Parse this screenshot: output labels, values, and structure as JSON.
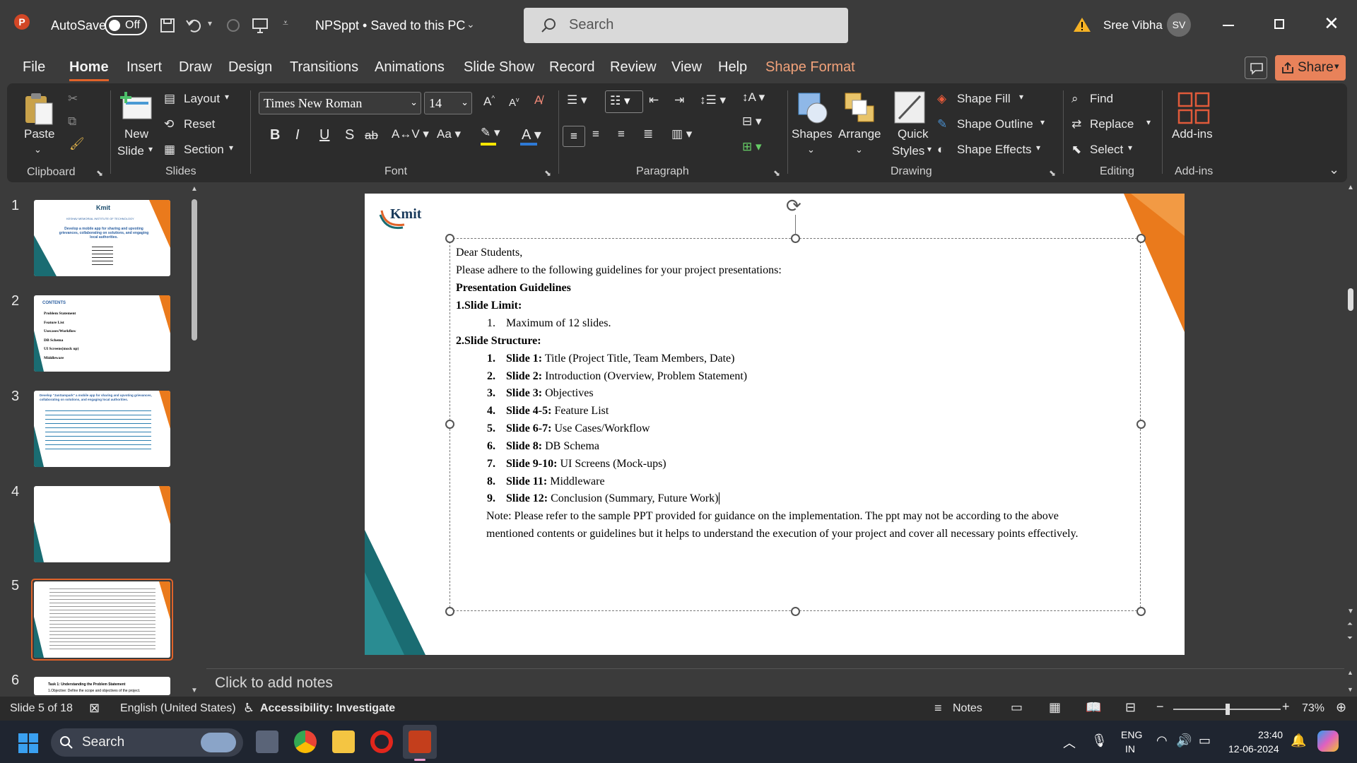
{
  "app": {
    "autosave_label": "AutoSave",
    "autosave_state": "Off",
    "doc_title": "NPSppt • Saved to this PC",
    "search_placeholder": "Search",
    "user_name": "Sree Vibha",
    "user_initials": "SV"
  },
  "menu": {
    "tabs": [
      "File",
      "Home",
      "Insert",
      "Draw",
      "Design",
      "Transitions",
      "Animations",
      "Slide Show",
      "Record",
      "Review",
      "View",
      "Help",
      "Shape Format"
    ],
    "active_tab": "Home",
    "share_label": "Share"
  },
  "ribbon": {
    "clipboard": {
      "paste": "Paste",
      "group": "Clipboard"
    },
    "slides": {
      "new_slide_1": "New",
      "new_slide_2": "Slide",
      "layout": "Layout",
      "reset": "Reset",
      "section": "Section",
      "group": "Slides"
    },
    "font": {
      "family": "Times New Roman",
      "size": "14",
      "bold": "B",
      "italic": "I",
      "underline": "U",
      "shadow": "S",
      "strike": "ab",
      "group": "Font"
    },
    "paragraph": {
      "group": "Paragraph"
    },
    "drawing": {
      "shapes": "Shapes",
      "arrange": "Arrange",
      "quick_styles_1": "Quick",
      "quick_styles_2": "Styles",
      "shape_fill": "Shape Fill",
      "shape_outline": "Shape Outline",
      "shape_effects": "Shape Effects",
      "group": "Drawing"
    },
    "editing": {
      "find": "Find",
      "replace": "Replace",
      "select": "Select",
      "group": "Editing"
    },
    "addins": {
      "label": "Add-ins",
      "group": "Add-ins"
    }
  },
  "thumbnails": [
    {
      "num": "1"
    },
    {
      "num": "2"
    },
    {
      "num": "3"
    },
    {
      "num": "4"
    },
    {
      "num": "5"
    },
    {
      "num": "6"
    }
  ],
  "thumb_text": {
    "t1_title": "KESHAV MEMORIAL INSTITUTE OF TECHNOLOGY",
    "t1_body": "Develop a mobile app for sharing and upvoting grievances, collaborating on solutions, and engaging local authorities.",
    "t2_heading": "CONTENTS",
    "t2_items": [
      "Problem Statement",
      "Feature List",
      "Usecases/Workflow",
      "DB Schema",
      "UI Screens(mock up)",
      "Middleware"
    ],
    "t3_title": "Develop \"JanSampark\" a mobile app for sharing and upvoting grievances, collaborating on solutions, and engaging local authorities.",
    "t6_title": "Task 1: Understanding the Problem Statement",
    "t6_line": "1.Objective: Define the scope and objectives of the project."
  },
  "slide": {
    "logo": "Kmit",
    "greeting": "Dear Students,",
    "intro": "Please adhere to the following guidelines for your project presentations:",
    "heading": "Presentation Guidelines",
    "sec1": "1.Slide Limit:",
    "sec1_item_num": "1.",
    "sec1_item": "Maximum of 12 slides.",
    "sec2": "2.Slide Structure:",
    "items": [
      {
        "num": "1.",
        "bold": "Slide 1:",
        "text": " Title (Project Title, Team Members, Date)"
      },
      {
        "num": "2.",
        "bold": "Slide 2:",
        "text": " Introduction (Overview, Problem Statement)"
      },
      {
        "num": "3.",
        "bold": "Slide 3:",
        "text": " Objectives"
      },
      {
        "num": "4.",
        "bold": "Slide 4-5:",
        "text": " Feature List"
      },
      {
        "num": "5.",
        "bold": "Slide 6-7:",
        "text": " Use Cases/Workflow"
      },
      {
        "num": "6.",
        "bold": "Slide 8:",
        "text": " DB Schema"
      },
      {
        "num": "7.",
        "bold": "Slide 9-10:",
        "text": " UI Screens (Mock-ups)"
      },
      {
        "num": "8.",
        "bold": "Slide 11:",
        "text": " Middleware"
      },
      {
        "num": "9.",
        "bold": "Slide 12:",
        "text": " Conclusion (Summary, Future Work)"
      }
    ],
    "note1": "Note: Please refer to the sample PPT provided for guidance on the implementation. The ppt may not be according to the above",
    "note2": "mentioned contents or guidelines but it helps to understand the execution of your project and cover all necessary points effectively."
  },
  "notes_placeholder": "Click to add notes",
  "status": {
    "slide_pos": "Slide 5 of 18",
    "language": "English (United States)",
    "accessibility": "Accessibility: Investigate",
    "notes": "Notes",
    "zoom": "73%"
  },
  "taskbar": {
    "search": "Search",
    "lang1": "ENG",
    "lang2": "IN",
    "time": "23:40",
    "date": "12-06-2024"
  },
  "colors": {
    "accent": "#e0632a",
    "brand_orange": "#ea7a1c",
    "teal": "#1a6c72"
  }
}
